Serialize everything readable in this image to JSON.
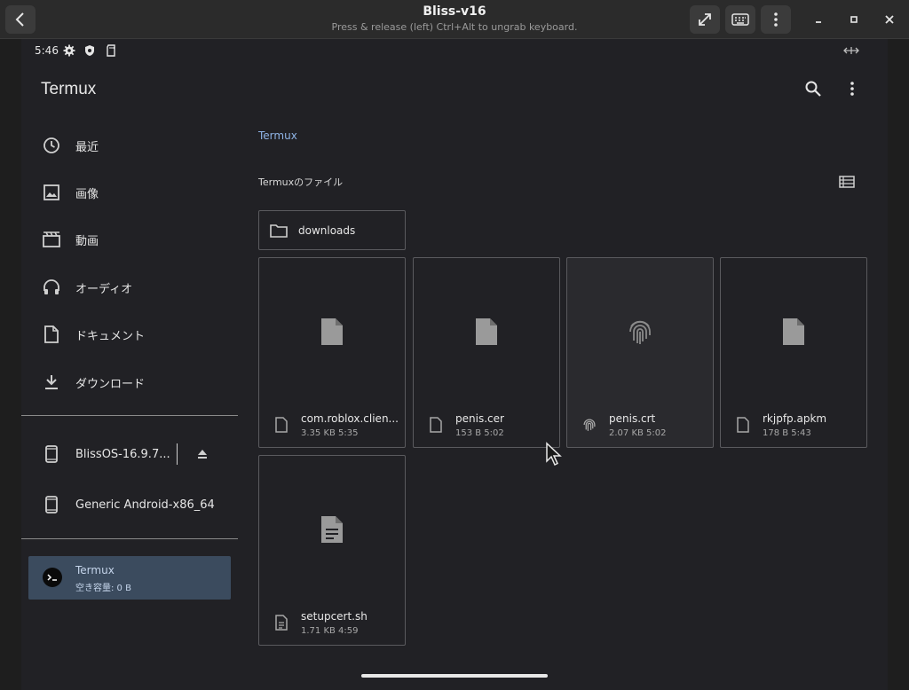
{
  "window": {
    "title": "Bliss-v16",
    "subtitle": "Press & release (left) Ctrl+Alt to ungrab keyboard."
  },
  "statusbar": {
    "time": "5:46"
  },
  "appbar": {
    "title": "Termux"
  },
  "drawer": {
    "items": [
      {
        "label": "最近",
        "icon": "clock-icon"
      },
      {
        "label": "画像",
        "icon": "image-icon"
      },
      {
        "label": "動画",
        "icon": "movie-icon"
      },
      {
        "label": "オーディオ",
        "icon": "headphones-icon"
      },
      {
        "label": "ドキュメント",
        "icon": "document-icon"
      },
      {
        "label": "ダウンロード",
        "icon": "download-icon"
      }
    ],
    "devices": [
      {
        "label": "BlissOS-16.9.7...",
        "icon": "phone-icon"
      },
      {
        "label": "Generic Android-x86_64",
        "icon": "phone-icon"
      }
    ],
    "selected_root": {
      "title": "Termux",
      "subtitle": "空き容量: 0 B"
    }
  },
  "content": {
    "breadcrumb": "Termux",
    "section_title": "Termuxのファイル",
    "folder": {
      "label": "downloads"
    },
    "files": [
      {
        "name": "com.roblox.clien...",
        "meta": "3.35 KB 5:35",
        "icon": "file-icon"
      },
      {
        "name": "penis.cer",
        "meta": "153 B 5:02",
        "icon": "file-icon"
      },
      {
        "name": "penis.crt",
        "meta": "2.07 KB 5:02",
        "icon": "fingerprint-icon"
      },
      {
        "name": "rkjpfp.apkm",
        "meta": "178 B 5:43",
        "icon": "file-icon"
      },
      {
        "name": "setupcert.sh",
        "meta": "1.71 KB 4:59",
        "icon": "text-file-icon"
      }
    ]
  }
}
